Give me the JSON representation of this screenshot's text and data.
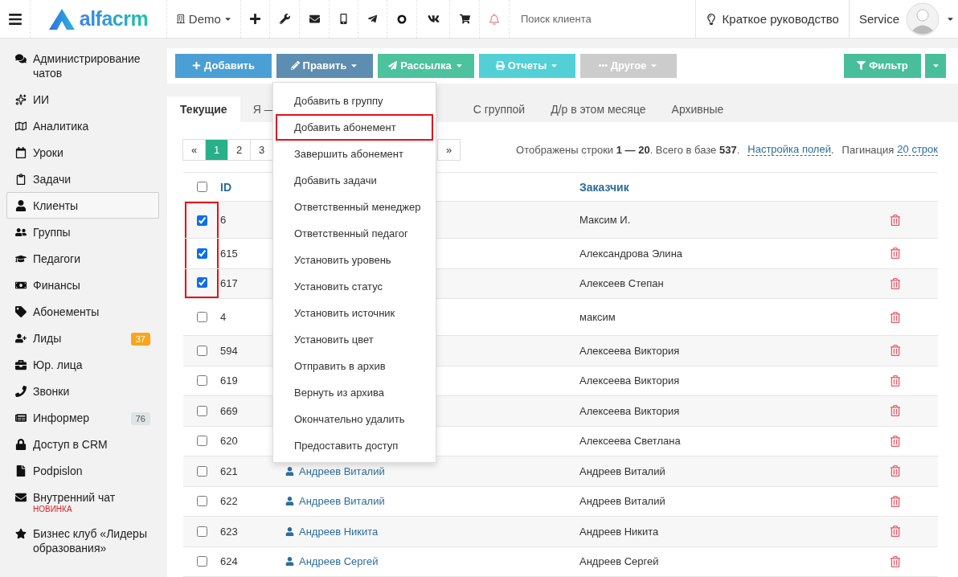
{
  "header": {
    "logo": "alfacrm",
    "account": "Demo",
    "search": {
      "placeholder": "Поиск клиента"
    },
    "guide": "Краткое руководство",
    "user": "Service"
  },
  "sidebar": {
    "items": [
      {
        "label": "Администрирование чатов",
        "selected": false
      },
      {
        "label": "ИИ",
        "selected": false
      },
      {
        "label": "Аналитика",
        "selected": false
      },
      {
        "label": "Уроки",
        "selected": false
      },
      {
        "label": "Задачи",
        "selected": false
      },
      {
        "label": "Клиенты",
        "selected": true
      },
      {
        "label": "Группы",
        "selected": false
      },
      {
        "label": "Педагоги",
        "selected": false
      },
      {
        "label": "Финансы",
        "selected": false
      },
      {
        "label": "Абонементы",
        "selected": false
      },
      {
        "label": "Лиды",
        "selected": false,
        "badge": "37",
        "color": "#f9a61a"
      },
      {
        "label": "Юр. лица",
        "selected": false
      },
      {
        "label": "Звонки",
        "selected": false
      },
      {
        "label": "Информер",
        "selected": false,
        "badge": "76",
        "color": "#dfe3e5"
      },
      {
        "label": "Доступ в CRM",
        "selected": false
      },
      {
        "label": "Podpislon",
        "selected": false
      },
      {
        "label": "Внутренний чат",
        "selected": false,
        "note": "НОВИНКА"
      },
      {
        "label": "Бизнес клуб «Лидеры образования»",
        "selected": false
      }
    ]
  },
  "toolbar": {
    "buttons": [
      {
        "label": "Добавить",
        "color": "#4a9fd4",
        "caret": false
      },
      {
        "label": "Править",
        "color": "#5d8db0",
        "caret": true
      },
      {
        "label": "Рассылка",
        "color": "#4cc29d",
        "caret": true
      },
      {
        "label": "Отчеты",
        "color": "#52d0d6",
        "caret": true
      },
      {
        "label": "Другое",
        "color": "#cccccc",
        "caret": true
      }
    ],
    "filter": "Фильтр"
  },
  "edit_menu": {
    "items": [
      {
        "label": "Добавить в группу",
        "highlighted": false
      },
      {
        "label": "Добавить абонемент",
        "highlighted": true
      },
      {
        "label": "Завершить абонемент",
        "highlighted": false
      },
      {
        "label": "Добавить задачи",
        "highlighted": false
      },
      {
        "label": "Ответственный менеджер",
        "highlighted": false
      },
      {
        "label": "Ответственный педагог",
        "highlighted": false
      },
      {
        "label": "Установить уровень",
        "highlighted": false
      },
      {
        "label": "Установить статус",
        "highlighted": false
      },
      {
        "label": "Установить источник",
        "highlighted": false
      },
      {
        "label": "Установить цвет",
        "highlighted": false
      },
      {
        "label": "Отправить в архив",
        "highlighted": false
      },
      {
        "label": "Вернуть из архива",
        "highlighted": false
      },
      {
        "label": "Окончательно удалить",
        "highlighted": false
      },
      {
        "label": "Предоставить доступ",
        "highlighted": false
      }
    ]
  },
  "tabs": [
    {
      "label": "Текущие",
      "selected": true
    },
    {
      "label": "Я —",
      "selected": false
    },
    {
      "label": "С группой",
      "selected": false
    },
    {
      "label": "Д/р в этом месяце",
      "selected": false
    },
    {
      "label": "Архивные",
      "selected": false
    }
  ],
  "pagination": {
    "pages": [
      {
        "label": "«",
        "selected": false
      },
      {
        "label": "1",
        "selected": true
      },
      {
        "label": "2",
        "selected": false
      },
      {
        "label": "3",
        "selected": false
      },
      {
        "label": "»",
        "selected": false
      }
    ],
    "summary": "Отображены строки **1 — 20**. Всего в базе **537**.",
    "fields_link": "Настройка полей",
    "fields_dot": ".",
    "pagination_label": "Пагинация",
    "rows_link": "20 строк"
  },
  "table": {
    "all_checked": false,
    "columns": [
      "ID",
      "Заказчик"
    ],
    "rows": [
      {
        "checked": true,
        "marked": true,
        "id": "6",
        "customer": "Максим И."
      },
      {
        "checked": true,
        "marked": true,
        "id": "615",
        "customer": "Александрова Элина"
      },
      {
        "checked": true,
        "marked": true,
        "id": "617",
        "customer": "Алексеев Степан"
      },
      {
        "checked": false,
        "marked": false,
        "id": "4",
        "customer": "максим"
      },
      {
        "checked": false,
        "marked": false,
        "id": "594",
        "customer": "Алексеева Виктория"
      },
      {
        "checked": false,
        "marked": false,
        "id": "619",
        "customer": "Алексеева Виктория"
      },
      {
        "checked": false,
        "marked": false,
        "id": "669",
        "customer": "Алексеева Виктория"
      },
      {
        "checked": false,
        "marked": false,
        "id": "620",
        "customer": "Алексеева Светлана"
      },
      {
        "checked": false,
        "marked": false,
        "id": "621",
        "name": "Андреев Виталий",
        "customer": "Андреев Виталий"
      },
      {
        "checked": false,
        "marked": false,
        "id": "622",
        "name": "Андреев Виталий",
        "customer": "Андреев Виталий"
      },
      {
        "checked": false,
        "marked": false,
        "id": "623",
        "name": "Андреев Никита",
        "customer": "Андреев Никита"
      },
      {
        "checked": false,
        "marked": false,
        "id": "624",
        "name": "Андреев Сергей",
        "customer": "Андреев Сергей"
      }
    ]
  }
}
